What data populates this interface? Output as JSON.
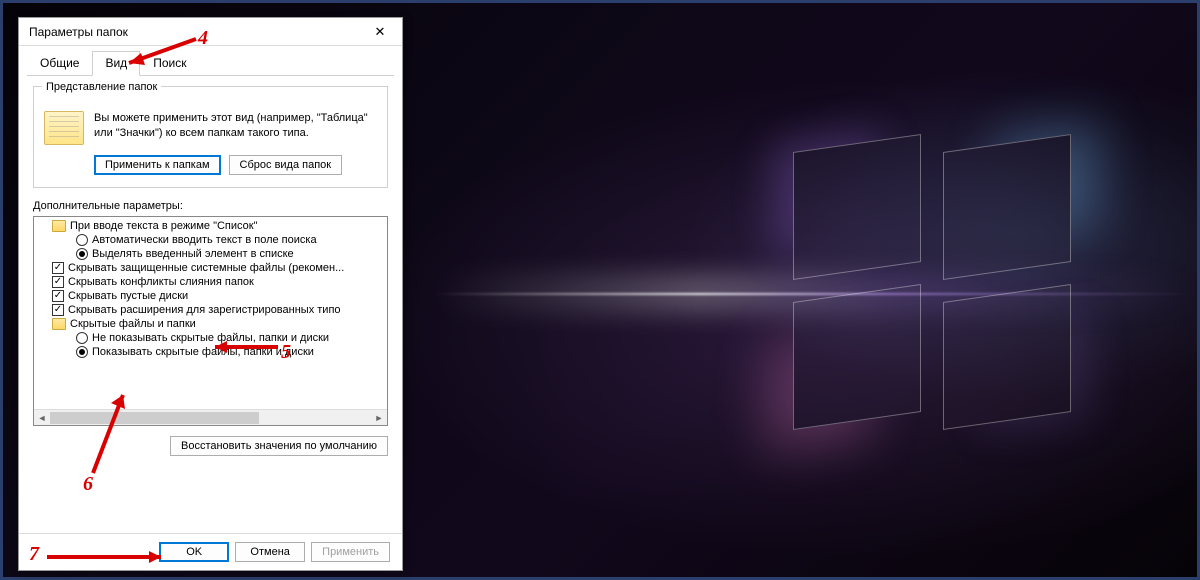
{
  "window": {
    "title": "Параметры папок",
    "close_glyph": "✕"
  },
  "tabs": {
    "general": "Общие",
    "view": "Вид",
    "search": "Поиск"
  },
  "folder_views": {
    "group_title": "Представление папок",
    "description": "Вы можете применить этот вид (например, \"Таблица\" или \"Значки\") ко всем папкам такого типа.",
    "apply_btn": "Применить к папкам",
    "reset_btn": "Сброс вида папок"
  },
  "advanced": {
    "label": "Дополнительные параметры:",
    "items": {
      "list_mode": "При вводе текста в режиме \"Список\"",
      "auto_type": "Автоматически вводить текст в поле поиска",
      "select_typed": "Выделять введенный элемент в списке",
      "hide_protected": "Скрывать защищенные системные файлы (рекомен...",
      "hide_merge": "Скрывать конфликты слияния папок",
      "hide_empty": "Скрывать пустые диски",
      "hide_ext": "Скрывать расширения для зарегистрированных типо",
      "hidden_group": "Скрытые файлы и папки",
      "dont_show": "Не показывать скрытые файлы, папки и диски",
      "show": "Показывать скрытые файлы, папки и диски"
    },
    "restore_btn": "Восстановить значения по умолчанию"
  },
  "footer": {
    "ok": "OK",
    "cancel": "Отмена",
    "apply": "Применить"
  },
  "annotations": {
    "n4": "4",
    "n5": "5",
    "n6": "6",
    "n7": "7"
  }
}
